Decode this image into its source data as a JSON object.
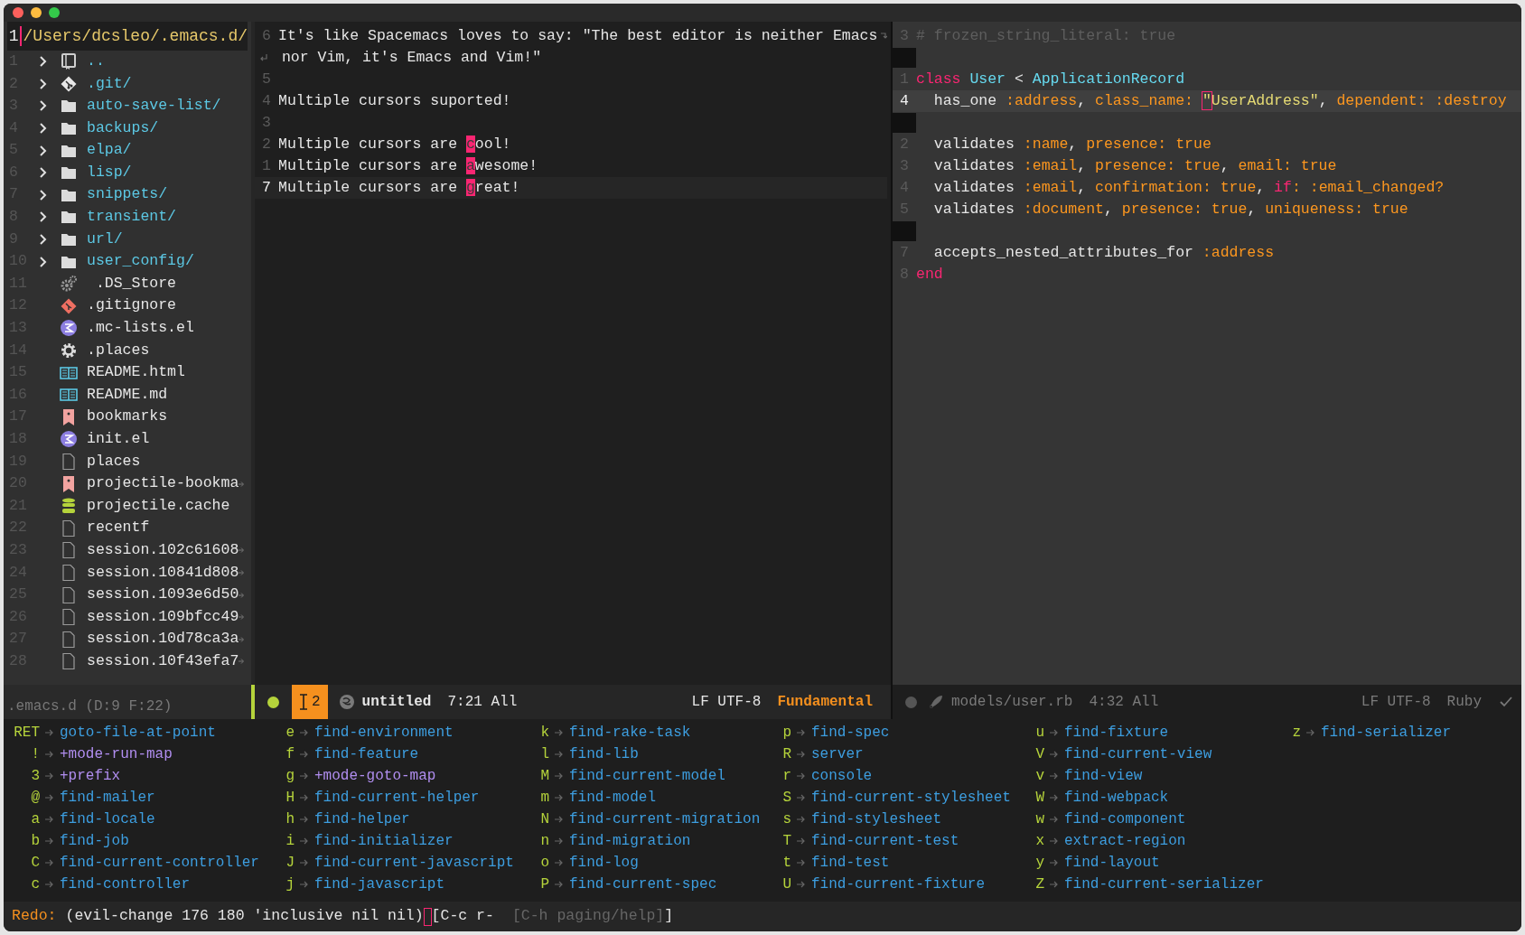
{
  "tree": {
    "header": {
      "line": "1",
      "path": "/Users/dcsleo/.emacs.d/"
    },
    "items": [
      {
        "line": "1",
        "kind": "parent",
        "name": "..",
        "expanded": false
      },
      {
        "line": "2",
        "kind": "git-folder",
        "name": ".git/",
        "expanded": false
      },
      {
        "line": "3",
        "kind": "folder",
        "name": "auto-save-list/",
        "expanded": false
      },
      {
        "line": "4",
        "kind": "folder",
        "name": "backups/",
        "expanded": false
      },
      {
        "line": "5",
        "kind": "folder",
        "name": "elpa/",
        "expanded": false
      },
      {
        "line": "6",
        "kind": "folder",
        "name": "lisp/",
        "expanded": false
      },
      {
        "line": "7",
        "kind": "folder",
        "name": "snippets/",
        "expanded": false
      },
      {
        "line": "8",
        "kind": "folder",
        "name": "transient/",
        "expanded": false
      },
      {
        "line": "9",
        "kind": "folder",
        "name": "url/",
        "expanded": false
      },
      {
        "line": "10",
        "kind": "folder",
        "name": "user_config/",
        "expanded": false
      },
      {
        "line": "11",
        "kind": "gears",
        "name": " .DS_Store"
      },
      {
        "line": "12",
        "kind": "git-file",
        "name": ".gitignore"
      },
      {
        "line": "13",
        "kind": "elisp",
        "name": ".mc-lists.el"
      },
      {
        "line": "14",
        "kind": "gear",
        "name": ".places"
      },
      {
        "line": "15",
        "kind": "readme",
        "name": "README.html"
      },
      {
        "line": "16",
        "kind": "readme",
        "name": "README.md"
      },
      {
        "line": "17",
        "kind": "bookmark",
        "name": "bookmarks"
      },
      {
        "line": "18",
        "kind": "elisp",
        "name": "init.el"
      },
      {
        "line": "19",
        "kind": "file",
        "name": "places"
      },
      {
        "line": "20",
        "kind": "bookmark",
        "name": "projectile-bookma",
        "truncated": true
      },
      {
        "line": "21",
        "kind": "database",
        "name": "projectile.cache"
      },
      {
        "line": "22",
        "kind": "file",
        "name": "recentf"
      },
      {
        "line": "23",
        "kind": "file",
        "name": "session.102c61608",
        "truncated": true
      },
      {
        "line": "24",
        "kind": "file",
        "name": "session.10841d808",
        "truncated": true
      },
      {
        "line": "25",
        "kind": "file",
        "name": "session.1093e6d50",
        "truncated": true
      },
      {
        "line": "26",
        "kind": "file",
        "name": "session.109bfcc49",
        "truncated": true
      },
      {
        "line": "27",
        "kind": "file",
        "name": "session.10d78ca3a",
        "truncated": true
      },
      {
        "line": "28",
        "kind": "file",
        "name": "session.10f43efa7",
        "truncated": true
      }
    ],
    "footer": ".emacs.d (D:9 F:22)"
  },
  "left_editor": {
    "lines": [
      {
        "number": "6",
        "current": false,
        "wrapped": true,
        "parts": [
          {
            "kind": "plain",
            "text": "It's like Spacemacs loves to say: \"The best editor is neither Emacs"
          }
        ]
      },
      {
        "current": false,
        "continuation": true,
        "parts": [
          {
            "kind": "plain",
            "text": " nor Vim, it's Emacs and Vim!\""
          }
        ]
      },
      {
        "number": "5",
        "current": false
      },
      {
        "number": "4",
        "current": false,
        "parts": [
          {
            "kind": "plain",
            "text": "Multiple cursors suported!"
          }
        ]
      },
      {
        "number": "3",
        "current": false
      },
      {
        "number": "2",
        "current": false,
        "parts": [
          {
            "kind": "plain",
            "text": "Multiple cursors are "
          },
          {
            "kind": "cursor",
            "text": "c"
          },
          {
            "kind": "plain",
            "text": "ool!"
          }
        ]
      },
      {
        "number": "1",
        "current": false,
        "parts": [
          {
            "kind": "plain",
            "text": "Multiple cursors are "
          },
          {
            "kind": "cursor",
            "text": "a"
          },
          {
            "kind": "plain",
            "text": "wesome!"
          }
        ]
      },
      {
        "number": "7",
        "current": true,
        "parts": [
          {
            "kind": "plain",
            "text": "Multiple cursors are "
          },
          {
            "kind": "cursor",
            "text": "g"
          },
          {
            "kind": "plain",
            "text": "reat!"
          }
        ]
      }
    ]
  },
  "right_editor": {
    "lines": [
      {
        "number": "3",
        "current": false,
        "parts": [
          {
            "kind": "comment",
            "text": "# frozen_string_literal: true"
          }
        ]
      },
      {
        "blank": true
      },
      {
        "number": "1",
        "current": false,
        "parts": [
          {
            "kind": "keyword",
            "text": "class"
          },
          {
            "kind": "type",
            "text": " User"
          },
          {
            "kind": "plain",
            "text": " < "
          },
          {
            "kind": "type",
            "text": "ApplicationRecord"
          }
        ]
      },
      {
        "number": "4",
        "current": true,
        "parts": [
          {
            "kind": "plain",
            "text": "  has_one "
          },
          {
            "kind": "symbol",
            "text": ":address"
          },
          {
            "kind": "plain",
            "text": ", "
          },
          {
            "kind": "symbol",
            "text": "class_name: "
          },
          {
            "kind": "box-cursor",
            "text": "\""
          },
          {
            "kind": "string",
            "text": "UserAddress\""
          },
          {
            "kind": "plain",
            "text": ", "
          },
          {
            "kind": "symbol",
            "text": "dependent: :destroy"
          }
        ]
      },
      {
        "blank": true
      },
      {
        "number": "2",
        "current": false,
        "parts": [
          {
            "kind": "plain",
            "text": "  validates "
          },
          {
            "kind": "symbol",
            "text": ":name"
          },
          {
            "kind": "plain",
            "text": ", "
          },
          {
            "kind": "symbol",
            "text": "presence: true"
          }
        ]
      },
      {
        "number": "3",
        "current": false,
        "parts": [
          {
            "kind": "plain",
            "text": "  validates "
          },
          {
            "kind": "symbol",
            "text": ":email"
          },
          {
            "kind": "plain",
            "text": ", "
          },
          {
            "kind": "symbol",
            "text": "presence: true"
          },
          {
            "kind": "plain",
            "text": ", "
          },
          {
            "kind": "symbol",
            "text": "email: true"
          }
        ]
      },
      {
        "number": "4",
        "current": false,
        "parts": [
          {
            "kind": "plain",
            "text": "  validates "
          },
          {
            "kind": "symbol",
            "text": ":email"
          },
          {
            "kind": "plain",
            "text": ", "
          },
          {
            "kind": "symbol",
            "text": "confirmation: true"
          },
          {
            "kind": "plain",
            "text": ", "
          },
          {
            "kind": "keyword",
            "text": "if"
          },
          {
            "kind": "symbol",
            "text": ": :email_changed?"
          }
        ]
      },
      {
        "number": "5",
        "current": false,
        "parts": [
          {
            "kind": "plain",
            "text": "  validates "
          },
          {
            "kind": "symbol",
            "text": ":document"
          },
          {
            "kind": "plain",
            "text": ", "
          },
          {
            "kind": "symbol",
            "text": "presence: true"
          },
          {
            "kind": "plain",
            "text": ", "
          },
          {
            "kind": "symbol",
            "text": "uniqueness: true"
          }
        ]
      },
      {
        "blank": true
      },
      {
        "number": "7",
        "current": false,
        "parts": [
          {
            "kind": "plain",
            "text": "  accepts_nested_attributes_for "
          },
          {
            "kind": "symbol",
            "text": ":address"
          }
        ]
      },
      {
        "number": "8",
        "current": false,
        "parts": [
          {
            "kind": "keyword",
            "text": "end"
          }
        ]
      }
    ]
  },
  "modelines": [
    {
      "active": true,
      "cursors": "2",
      "buffer": "untitled",
      "position": "7:21 All",
      "encoding": "LF UTF-8",
      "mode": "Fundamental",
      "syntax_ok": false
    },
    {
      "active": false,
      "buffer": "models/user.rb",
      "position": "4:32 All",
      "encoding": "LF UTF-8",
      "mode": "Ruby",
      "syntax_ok": true
    }
  ],
  "which_key": {
    "columns": [
      [
        {
          "key": "RET",
          "kind": "command",
          "command": "goto-file-at-point"
        },
        {
          "key": "!",
          "kind": "prefix",
          "command": "+mode-run-map"
        },
        {
          "key": "3",
          "kind": "prefix",
          "command": "+prefix"
        },
        {
          "key": "@",
          "kind": "command",
          "command": "find-mailer"
        },
        {
          "key": "a",
          "kind": "command",
          "command": "find-locale"
        },
        {
          "key": "b",
          "kind": "command",
          "command": "find-job"
        },
        {
          "key": "C",
          "kind": "command",
          "command": "find-current-controller"
        },
        {
          "key": "c",
          "kind": "command",
          "command": "find-controller"
        }
      ],
      [
        {
          "key": "e",
          "kind": "command",
          "command": "find-environment"
        },
        {
          "key": "f",
          "kind": "command",
          "command": "find-feature"
        },
        {
          "key": "g",
          "kind": "prefix",
          "command": "+mode-goto-map"
        },
        {
          "key": "H",
          "kind": "command",
          "command": "find-current-helper"
        },
        {
          "key": "h",
          "kind": "command",
          "command": "find-helper"
        },
        {
          "key": "i",
          "kind": "command",
          "command": "find-initializer"
        },
        {
          "key": "J",
          "kind": "command",
          "command": "find-current-javascript"
        },
        {
          "key": "j",
          "kind": "command",
          "command": "find-javascript"
        }
      ],
      [
        {
          "key": "k",
          "kind": "command",
          "command": "find-rake-task"
        },
        {
          "key": "l",
          "kind": "command",
          "command": "find-lib"
        },
        {
          "key": "M",
          "kind": "command",
          "command": "find-current-model"
        },
        {
          "key": "m",
          "kind": "command",
          "command": "find-model"
        },
        {
          "key": "N",
          "kind": "command",
          "command": "find-current-migration"
        },
        {
          "key": "n",
          "kind": "command",
          "command": "find-migration"
        },
        {
          "key": "o",
          "kind": "command",
          "command": "find-log"
        },
        {
          "key": "P",
          "kind": "command",
          "command": "find-current-spec"
        }
      ],
      [
        {
          "key": "p",
          "kind": "command",
          "command": "find-spec"
        },
        {
          "key": "R",
          "kind": "command",
          "command": "server"
        },
        {
          "key": "r",
          "kind": "command",
          "command": "console"
        },
        {
          "key": "S",
          "kind": "command",
          "command": "find-current-stylesheet"
        },
        {
          "key": "s",
          "kind": "command",
          "command": "find-stylesheet"
        },
        {
          "key": "T",
          "kind": "command",
          "command": "find-current-test"
        },
        {
          "key": "t",
          "kind": "command",
          "command": "find-test"
        },
        {
          "key": "U",
          "kind": "command",
          "command": "find-current-fixture"
        }
      ],
      [
        {
          "key": "u",
          "kind": "command",
          "command": "find-fixture"
        },
        {
          "key": "V",
          "kind": "command",
          "command": "find-current-view"
        },
        {
          "key": "v",
          "kind": "command",
          "command": "find-view"
        },
        {
          "key": "W",
          "kind": "command",
          "command": "find-webpack"
        },
        {
          "key": "w",
          "kind": "command",
          "command": "find-component"
        },
        {
          "key": "x",
          "kind": "command",
          "command": "extract-region"
        },
        {
          "key": "y",
          "kind": "command",
          "command": "find-layout"
        },
        {
          "key": "Z",
          "kind": "command",
          "command": "find-current-serializer"
        }
      ],
      [
        {
          "key": "z",
          "kind": "command",
          "command": "find-serializer"
        }
      ]
    ]
  },
  "echo_area": {
    "label": "Redo:",
    "message": "(evil-change 176 180 'inclusive nil nil)",
    "prefix_keys": "[C-c r-",
    "hint": "[C-h paging/help]",
    "closing": "]"
  }
}
